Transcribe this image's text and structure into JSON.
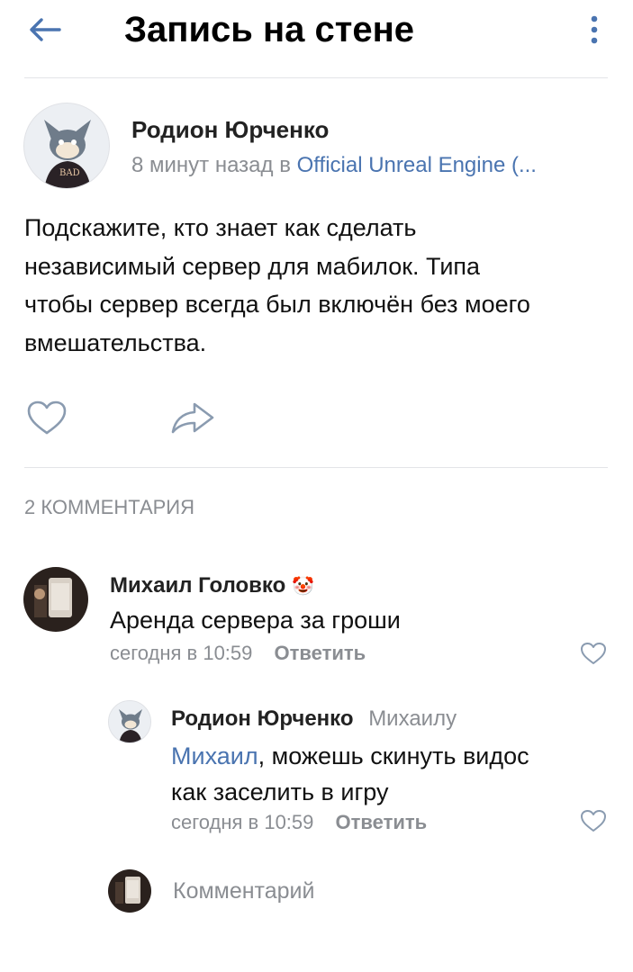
{
  "header": {
    "title": "Запись на стене",
    "back_icon": "arrow-left-icon",
    "menu_icon": "more-vertical-icon"
  },
  "post": {
    "author": "Родион Юрченко",
    "time": "8 минут назад",
    "in_word": "в",
    "community": "Official Unreal Engine (...",
    "text_lines": [
      "Подскажите, кто знает как сделать",
      "независимый сервер для мабилок. Типа",
      "чтобы сервер всегда был включён без моего",
      "вмешательства."
    ],
    "avatar_text": "BAD",
    "like_icon": "heart-icon",
    "share_icon": "share-arrow-icon"
  },
  "comments": {
    "header": "2 КОММЕНТАРИЯ",
    "items": [
      {
        "author": "Михаил Головко",
        "author_emoji": "🤡",
        "text": "Аренда сервера за гроши",
        "time": "сегодня в 10:59",
        "reply_label": "Ответить"
      },
      {
        "author": "Родион Юрченко",
        "reply_to": "Михаилу",
        "mention": "Михаил",
        "text_line1_rest": ", можешь скинуть видос",
        "text_line2": "как заселить в игру",
        "time": "сегодня в 10:59",
        "reply_label": "Ответить"
      }
    ]
  },
  "composer": {
    "placeholder": "Комментарий"
  },
  "colors": {
    "accent": "#4a74b0",
    "secondary_text": "#8a8d92",
    "divider": "#e3e4e8"
  }
}
